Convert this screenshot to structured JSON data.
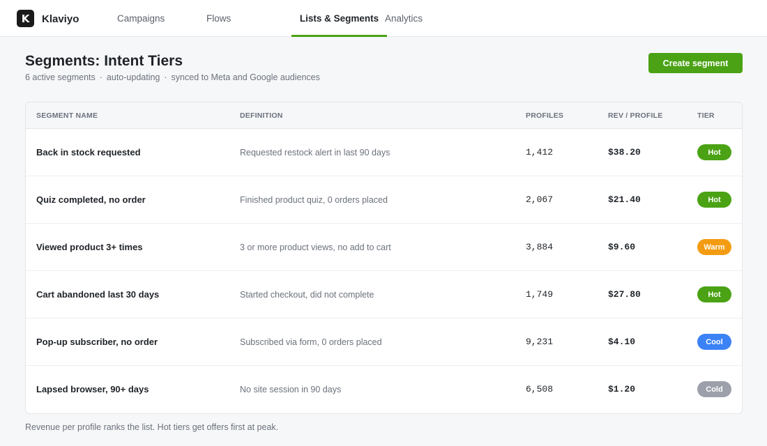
{
  "app": {
    "logo_letter": "K",
    "brand": "Klaviyo"
  },
  "nav": {
    "tabs": [
      {
        "label": "Campaigns",
        "active": false
      },
      {
        "label": "Flows",
        "active": false
      },
      {
        "label": "Lists & Segments",
        "active": true
      },
      {
        "label": "Analytics",
        "active": false
      }
    ]
  },
  "header": {
    "title": "Segments: Intent Tiers",
    "subtitle_parts": [
      "6 active segments",
      "auto-updating",
      "synced to Meta and Google audiences"
    ],
    "separator": "·",
    "create_button": "Create segment"
  },
  "table": {
    "columns": [
      "Segment name",
      "Definition",
      "Profiles",
      "Rev / Profile",
      "Tier"
    ],
    "rows": [
      {
        "name": "Back in stock requested",
        "definition": "Requested restock alert in last 90 days",
        "profiles": "1,412",
        "rev": "$38.20",
        "tier": "Hot"
      },
      {
        "name": "Quiz completed, no order",
        "definition": "Finished product quiz, 0 orders placed",
        "profiles": "2,067",
        "rev": "$21.40",
        "tier": "Hot"
      },
      {
        "name": "Viewed product 3+ times",
        "definition": "3 or more product views, no add to cart",
        "profiles": "3,884",
        "rev": "$9.60",
        "tier": "Warm"
      },
      {
        "name": "Cart abandoned last 30 days",
        "definition": "Started checkout, did not complete",
        "profiles": "1,749",
        "rev": "$27.80",
        "tier": "Hot"
      },
      {
        "name": "Pop-up subscriber, no order",
        "definition": "Subscribed via form, 0 orders placed",
        "profiles": "9,231",
        "rev": "$4.10",
        "tier": "Cool"
      },
      {
        "name": "Lapsed browser, 90+ days",
        "definition": "No site session in 90 days",
        "profiles": "6,508",
        "rev": "$1.20",
        "tier": "Cold"
      }
    ]
  },
  "footnote": "Revenue per profile ranks the list. Hot tiers get offers first at peak.",
  "colors": {
    "accent": "#4aa214",
    "hot": "#4aa214",
    "warm": "#f39c12",
    "cool": "#3b82f6",
    "cold": "#9ca0aa"
  }
}
